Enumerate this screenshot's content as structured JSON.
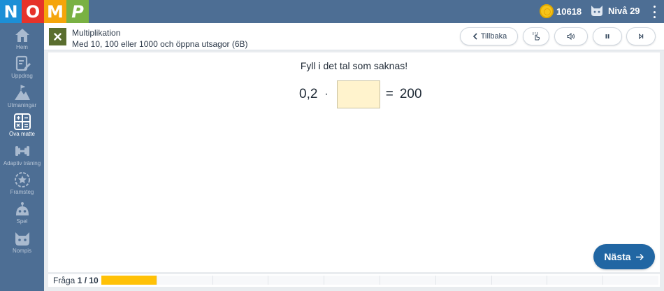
{
  "logo": [
    "N",
    "O",
    "M",
    "P"
  ],
  "topbar": {
    "coins": "10618",
    "level": "Nivå 29",
    "coin_icon": "coin-icon",
    "cat_icon": "nompis-cat-icon",
    "menu_icon": "kebab-menu-icon"
  },
  "sidebar": {
    "items": [
      {
        "label": "Hem",
        "icon": "home-icon"
      },
      {
        "label": "Uppdrag",
        "icon": "assignment-icon"
      },
      {
        "label": "Utmaningar",
        "icon": "mountain-flag-icon"
      },
      {
        "label": "Öva matte",
        "icon": "calculator-icon",
        "active": true
      },
      {
        "label": "Adaptiv träning",
        "icon": "dumbbell-icon"
      },
      {
        "label": "Framsteg",
        "icon": "progress-star-icon"
      },
      {
        "label": "Spel",
        "icon": "game-robot-icon"
      },
      {
        "label": "Nompis",
        "icon": "nompis-icon"
      }
    ]
  },
  "header": {
    "category": "Multiplikation",
    "subtitle": "Med 10, 100 eller 1000 och öppna utsagor (6B)",
    "back_label": "Tillbaka"
  },
  "exercise": {
    "instruction": "Fyll i det tal som saknas!",
    "factor": "0,2",
    "operator": "·",
    "answer_value": "",
    "equals": "=",
    "result": "200"
  },
  "next_label": "Nästa",
  "footer": {
    "question_prefix": "Fråga",
    "question_current": "1 / 10",
    "progress_current": 1,
    "progress_total": 10
  },
  "colors": {
    "topbar": "#4d6e94",
    "next_button": "#2166a3",
    "progress_fill": "#ffc107",
    "answer_box": "#fff3cd"
  }
}
